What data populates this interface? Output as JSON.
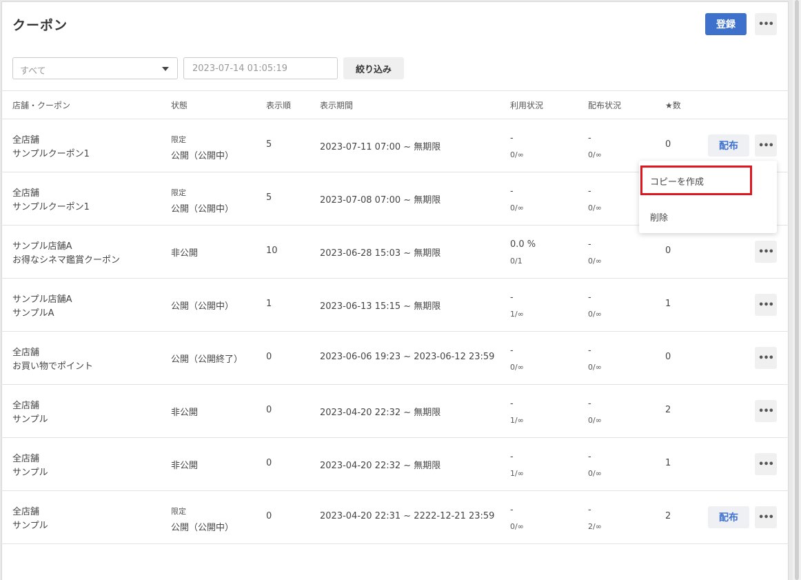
{
  "header": {
    "title": "クーポン",
    "register_label": "登録",
    "more_label": "•••"
  },
  "filters": {
    "select_value": "すべて",
    "date_placeholder": "2023-07-14 01:05:19",
    "filter_button": "絞り込み"
  },
  "table": {
    "columns": [
      "店舗・クーポン",
      "状態",
      "表示順",
      "表示期間",
      "利用状況",
      "配布状況",
      "★数"
    ],
    "rows": [
      {
        "store": "全店舗",
        "coupon": "サンプルクーポン1",
        "status_tag": "限定",
        "status": "公開（公開中）",
        "order": "5",
        "period": "2023-07-11 07:00 ~ 無期限",
        "usage_rate": "-",
        "usage": "0/∞",
        "dist_rate": "-",
        "dist": "0/∞",
        "stars": "0",
        "action": "配布"
      },
      {
        "store": "全店舗",
        "coupon": "サンプルクーポン1",
        "status_tag": "限定",
        "status": "公開（公開中）",
        "order": "5",
        "period": "2023-07-08 07:00 ~ 無期限",
        "usage_rate": "-",
        "usage": "0/∞",
        "dist_rate": "-",
        "dist": "0/∞",
        "stars": "",
        "action": ""
      },
      {
        "store": "サンプル店舗A",
        "coupon": "お得なシネマ鑑賞クーポン",
        "status_tag": "",
        "status": "非公開",
        "order": "10",
        "period": "2023-06-28 15:03 ~ 無期限",
        "usage_rate": "0.0 %",
        "usage": "0/1",
        "dist_rate": "-",
        "dist": "0/∞",
        "stars": "0",
        "action": ""
      },
      {
        "store": "サンプル店舗A",
        "coupon": "サンプルA",
        "status_tag": "",
        "status": "公開（公開中）",
        "order": "1",
        "period": "2023-06-13 15:15 ~ 無期限",
        "usage_rate": "-",
        "usage": "1/∞",
        "dist_rate": "-",
        "dist": "0/∞",
        "stars": "1",
        "action": ""
      },
      {
        "store": "全店舗",
        "coupon": "お買い物でポイント",
        "status_tag": "",
        "status": "公開（公開終了）",
        "order": "0",
        "period": "2023-06-06 19:23 ~ 2023-06-12 23:59",
        "usage_rate": "-",
        "usage": "0/∞",
        "dist_rate": "-",
        "dist": "0/∞",
        "stars": "0",
        "action": ""
      },
      {
        "store": "全店舗",
        "coupon": "サンプル",
        "status_tag": "",
        "status": "非公開",
        "order": "0",
        "period": "2023-04-20 22:32 ~ 無期限",
        "usage_rate": "-",
        "usage": "1/∞",
        "dist_rate": "-",
        "dist": "0/∞",
        "stars": "2",
        "action": ""
      },
      {
        "store": "全店舗",
        "coupon": "サンプル",
        "status_tag": "",
        "status": "非公開",
        "order": "0",
        "period": "2023-04-20 22:32 ~ 無期限",
        "usage_rate": "-",
        "usage": "1/∞",
        "dist_rate": "-",
        "dist": "0/∞",
        "stars": "1",
        "action": ""
      },
      {
        "store": "全店舗",
        "coupon": "サンプル",
        "status_tag": "限定",
        "status": "公開（公開中）",
        "order": "0",
        "period": "2023-04-20 22:31 ~ 2222-12-21 23:59",
        "usage_rate": "-",
        "usage": "0/∞",
        "dist_rate": "-",
        "dist": "2/∞",
        "stars": "2",
        "action": "配布"
      }
    ]
  },
  "context_menu": {
    "items": [
      "コピーを作成",
      "削除"
    ]
  },
  "colors": {
    "primary": "#3d71cc",
    "highlight": "#e0161e"
  }
}
